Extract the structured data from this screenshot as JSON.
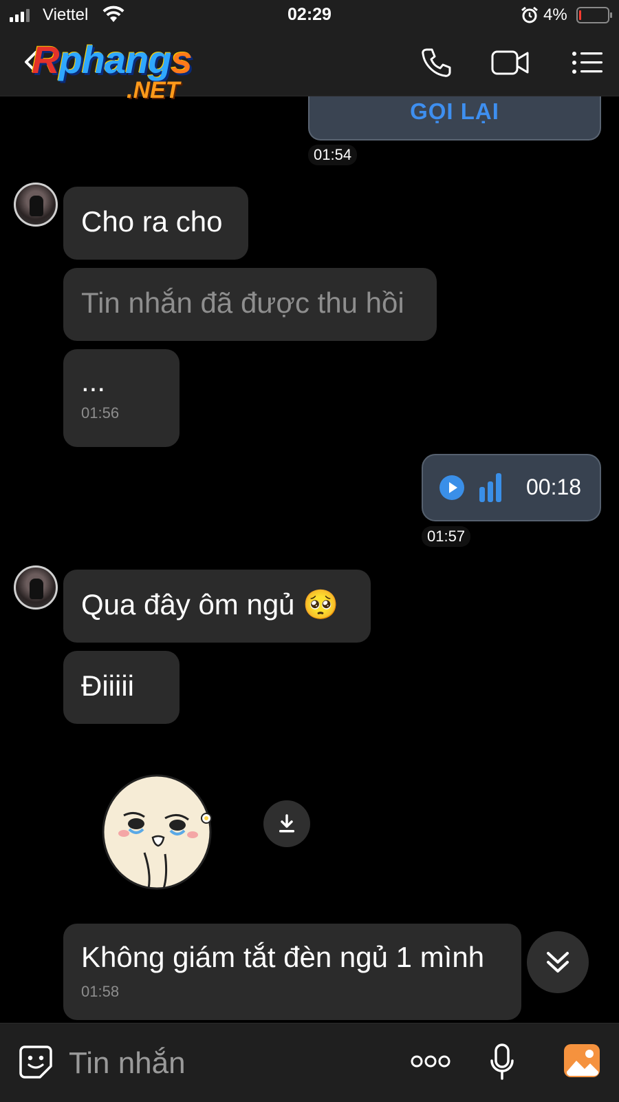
{
  "status_bar": {
    "carrier": "Viettel",
    "time": "02:29",
    "battery": "4%"
  },
  "header": {
    "logo": {
      "text_main_1": "R",
      "text_main_2": "phang",
      "text_main_3": "s",
      "text_net": ".NET"
    },
    "icons": [
      "back-icon",
      "phone-icon",
      "video-icon",
      "menu-icon"
    ]
  },
  "chat": {
    "callback_label": "GỌI LẠI",
    "callback_time": "01:54",
    "m1": "Cho ra cho",
    "m2_recalled": "Tin nhắn đã được thu hồi",
    "m3": "...",
    "m3_time": "01:56",
    "voice_duration": "00:18",
    "voice_time": "01:57",
    "m4": "Qua đây ôm ngủ 🥺",
    "m5": "Điiiii",
    "m6": "Không giám tắt đèn ngủ 1 mình",
    "m6_time": "01:58"
  },
  "input": {
    "placeholder": "Tin nhắn"
  },
  "colors": {
    "accent_blue": "#3e8ff0",
    "bubble": "#2b2b2b",
    "bar": "#1f1f1f",
    "gallery": "#f5923e"
  }
}
